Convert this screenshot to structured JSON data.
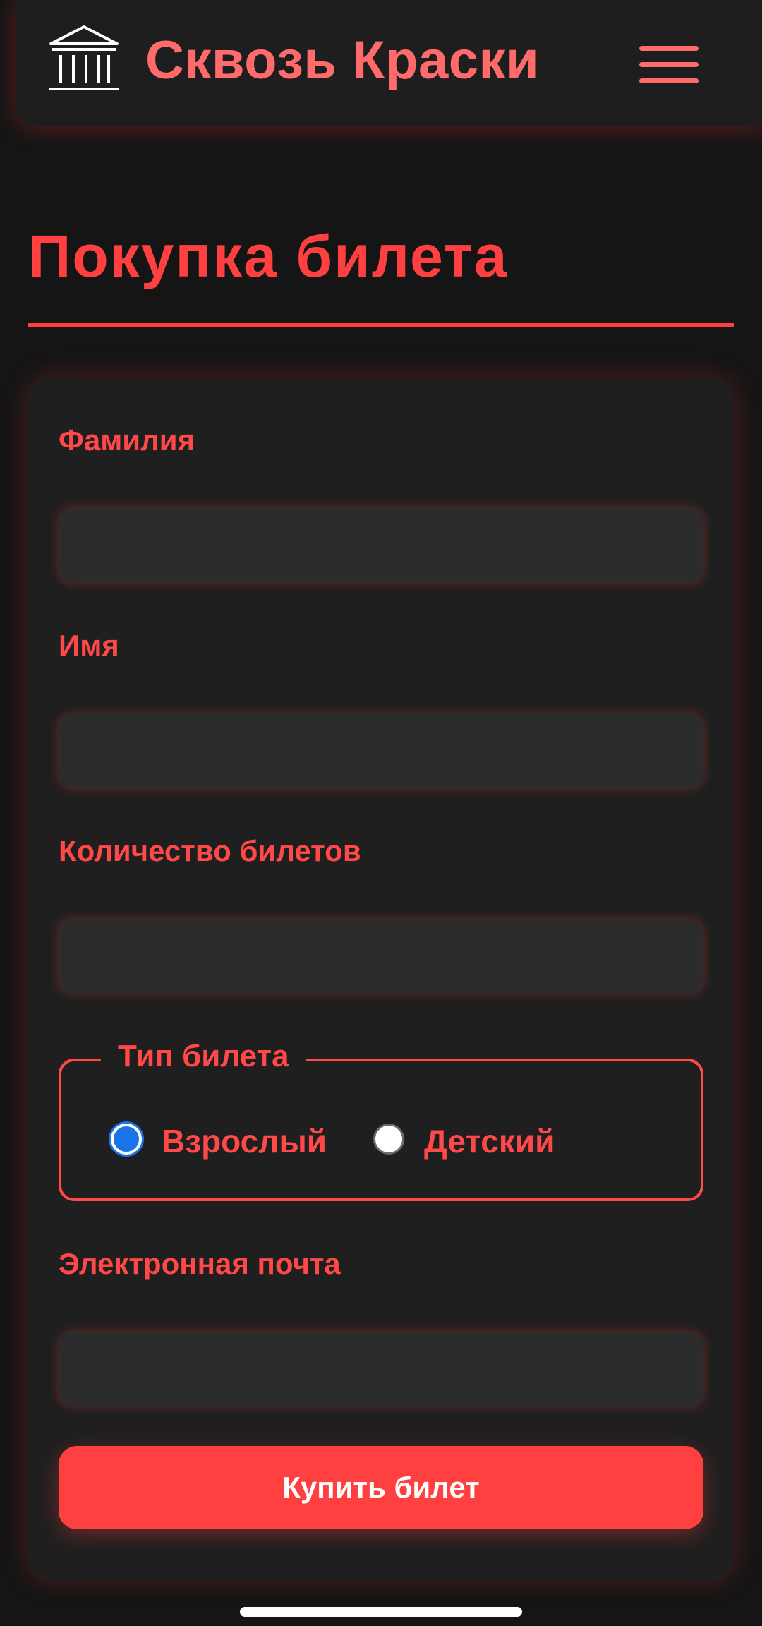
{
  "header": {
    "brand": "Сквозь Краски",
    "logo_icon": "museum-icon",
    "menu_icon": "hamburger-menu-icon"
  },
  "page": {
    "title": "Покупка билета"
  },
  "form": {
    "last_name_label": "Фамилия",
    "last_name_value": "",
    "first_name_label": "Имя",
    "first_name_value": "",
    "quantity_label": "Количество билетов",
    "quantity_value": "",
    "ticket_type": {
      "legend": "Тип билета",
      "options": [
        {
          "label": "Взрослый",
          "selected": true
        },
        {
          "label": "Детский",
          "selected": false
        }
      ]
    },
    "email_label": "Электронная почта",
    "email_value": "",
    "submit_label": "Купить билет"
  },
  "colors": {
    "accent": "#ff4040",
    "brand": "#ff6b6b",
    "background": "#151515",
    "card": "#1f1f1f",
    "field": "#2c2c2c",
    "radio_selected": "#1a73e8"
  }
}
